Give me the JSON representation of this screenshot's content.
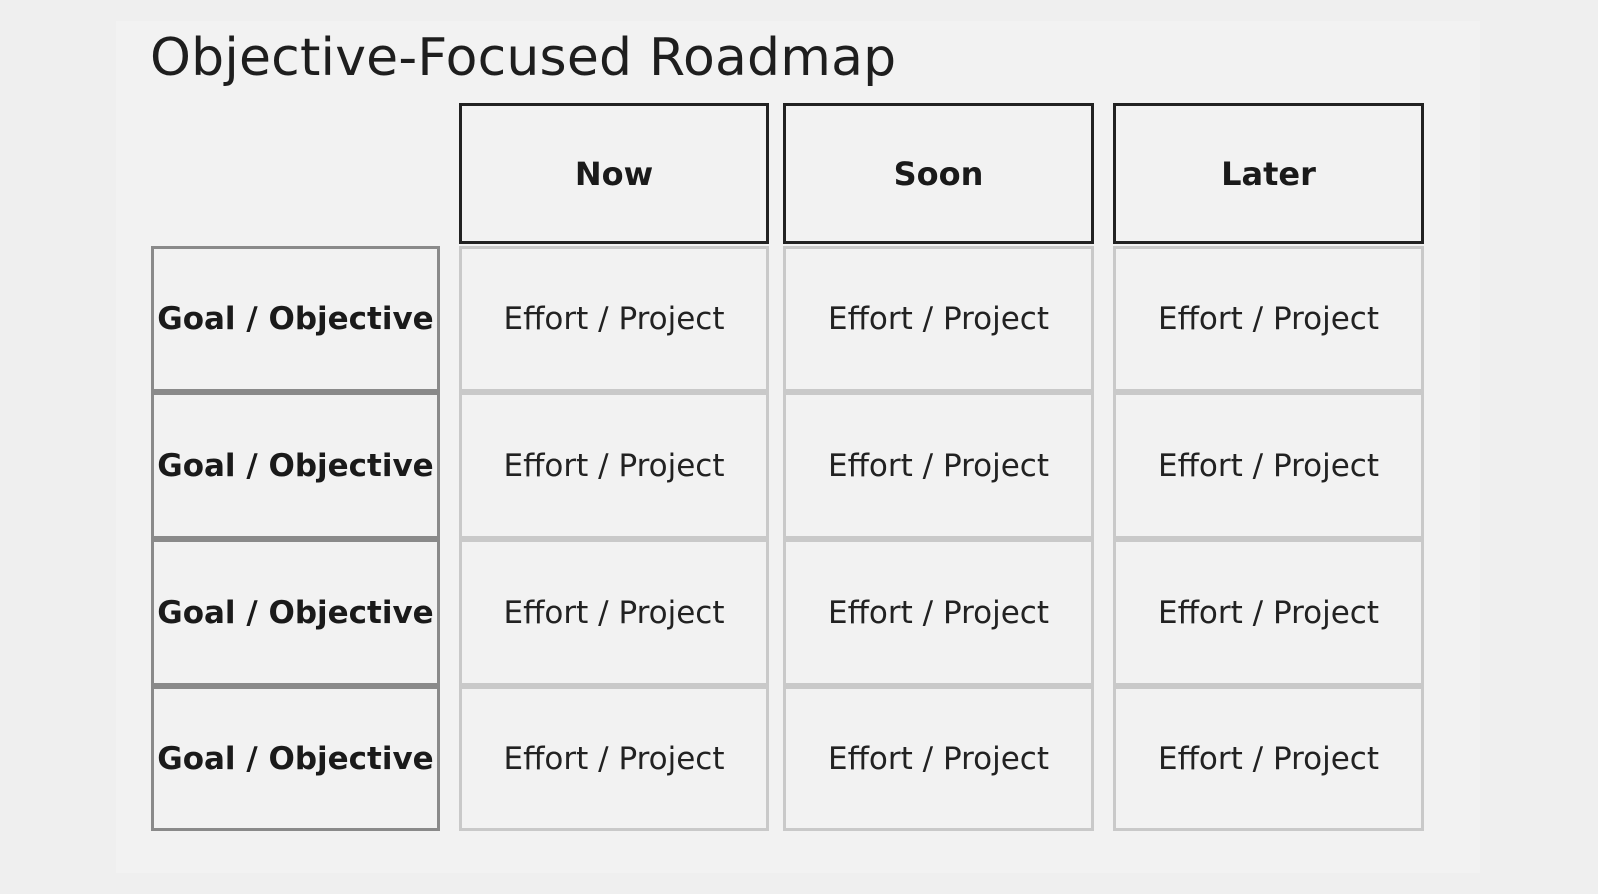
{
  "title": "Objective-Focused Roadmap",
  "columns": [
    {
      "label": "Now"
    },
    {
      "label": "Soon"
    },
    {
      "label": "Later"
    }
  ],
  "rows": [
    {
      "goal": "Goal / Objective",
      "cells": [
        "Effort / Project",
        "Effort / Project",
        "Effort / Project"
      ]
    },
    {
      "goal": "Goal / Objective",
      "cells": [
        "Effort / Project",
        "Effort / Project",
        "Effort / Project"
      ]
    },
    {
      "goal": "Goal / Objective",
      "cells": [
        "Effort / Project",
        "Effort / Project",
        "Effort / Project"
      ]
    },
    {
      "goal": "Goal / Objective",
      "cells": [
        "Effort / Project",
        "Effort / Project",
        "Effort / Project"
      ]
    }
  ],
  "colors": {
    "page_background": "#efefef",
    "panel_background": "#f2f2f2",
    "header_border": "#222222",
    "goal_border": "#8a8a8a",
    "cell_border": "#c9c9c9",
    "text": "#1c1c1c"
  }
}
